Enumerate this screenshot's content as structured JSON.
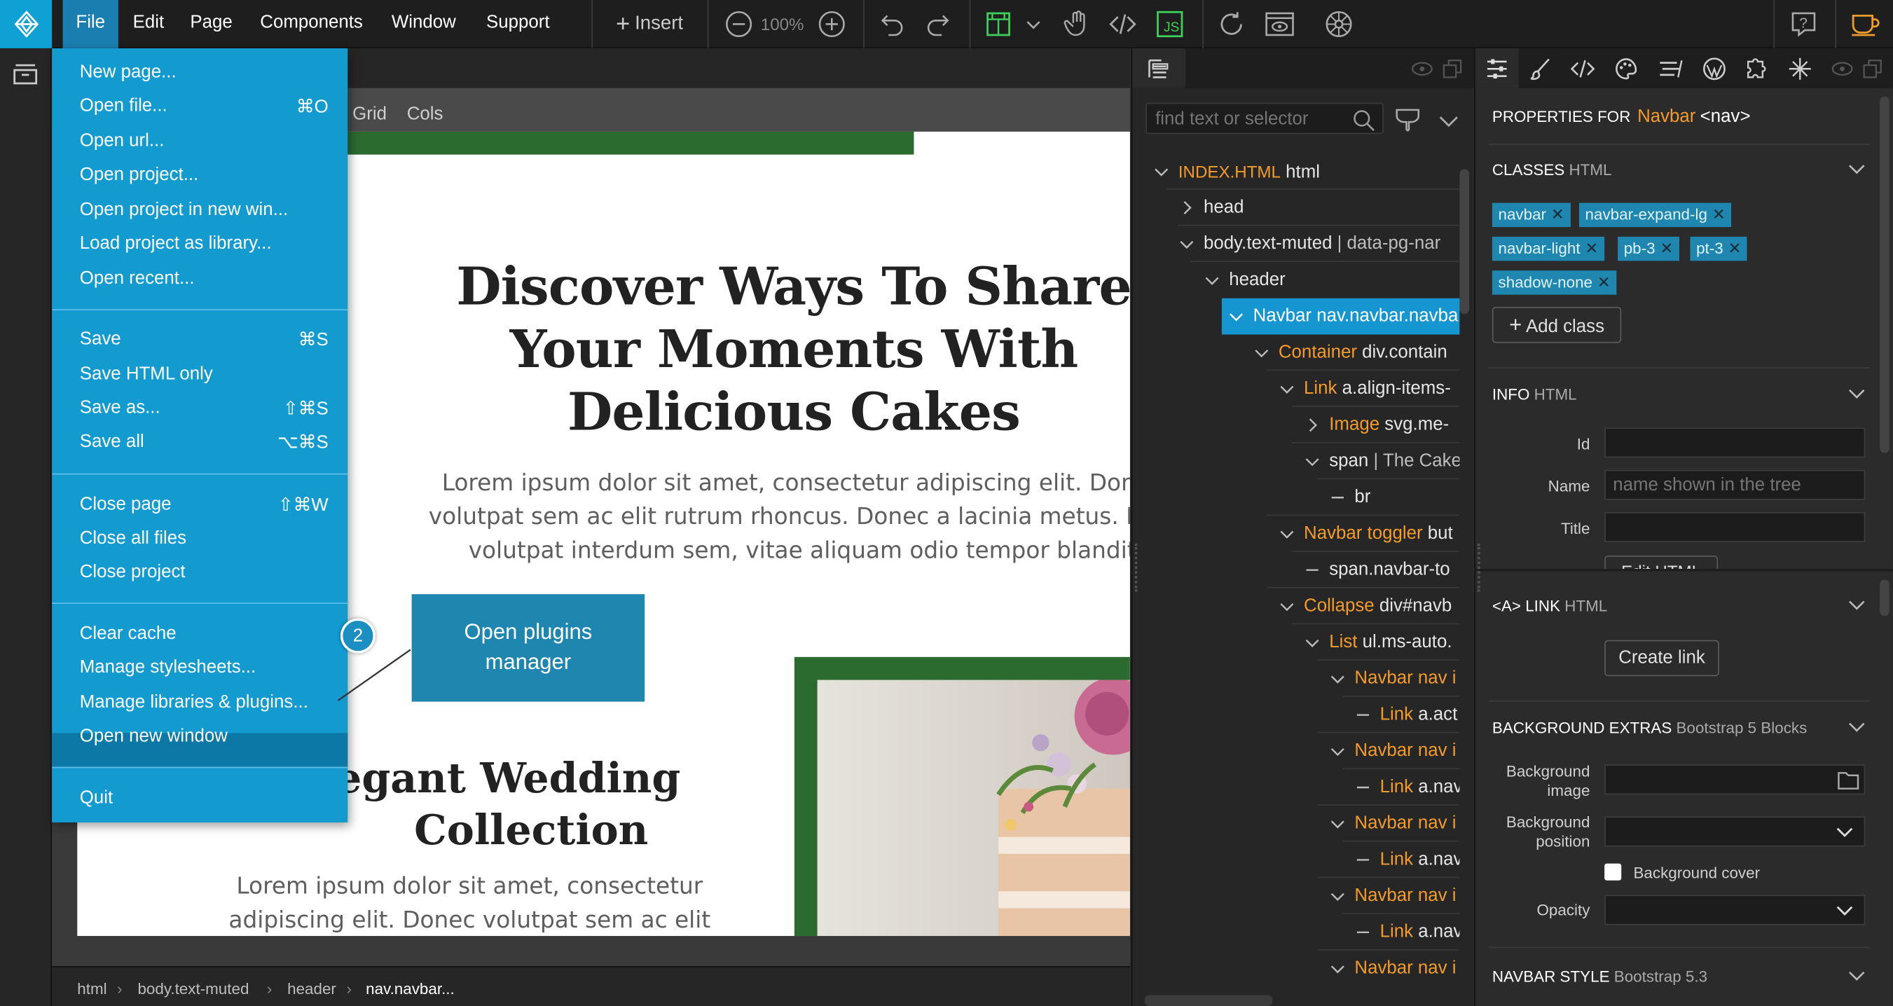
{
  "menubar": {
    "menus": [
      "File",
      "Edit",
      "Page",
      "Components",
      "Window",
      "Support"
    ],
    "insert_label": "Insert",
    "zoom": "100%"
  },
  "file_menu": {
    "items": [
      {
        "label": "New page...",
        "shortcut": ""
      },
      {
        "label": "Open file...",
        "shortcut": "⌘O"
      },
      {
        "label": "Open url...",
        "shortcut": ""
      },
      {
        "label": "Open project...",
        "shortcut": ""
      },
      {
        "label": "Open project in new win...",
        "shortcut": ""
      },
      {
        "label": "Load project as library...",
        "shortcut": ""
      },
      {
        "label": "Open recent...",
        "shortcut": ""
      },
      {
        "label": "Save",
        "shortcut": "⌘S"
      },
      {
        "label": "Save HTML only",
        "shortcut": ""
      },
      {
        "label": "Save as...",
        "shortcut": "⇧⌘S"
      },
      {
        "label": "Save all",
        "shortcut": "⌥⌘S"
      },
      {
        "label": "Close page",
        "shortcut": "⇧⌘W"
      },
      {
        "label": "Close all files",
        "shortcut": ""
      },
      {
        "label": "Close project",
        "shortcut": ""
      },
      {
        "label": "Clear cache",
        "shortcut": ""
      },
      {
        "label": "Manage stylesheets...",
        "shortcut": ""
      },
      {
        "label": "Manage libraries & plugins...",
        "shortcut": ""
      },
      {
        "label": "Open new window",
        "shortcut": ""
      },
      {
        "label": "Quit",
        "shortcut": ""
      }
    ],
    "highlighted": "Manage libraries & plugins..."
  },
  "callout": {
    "badge": "2",
    "line1": "Open plugins",
    "line2": "manager"
  },
  "canvas": {
    "grid_bar": [
      "Grid",
      "Cols"
    ],
    "hero_title_lines": [
      "Discover Ways To Share",
      "Your Moments With",
      "Delicious Cakes"
    ],
    "hero_text_lines": [
      "Lorem ipsum dolor sit amet, consectetur adipiscing elit. Donec",
      "volutpat sem ac elit rutrum rhoncus. Donec a lacinia metus. Mo",
      "volutpat interdum sem, vitae aliquam odio tempor blandit."
    ],
    "section_title_lines": [
      "egant Wedding",
      "Collection"
    ],
    "section_text_lines": [
      "Lorem ipsum dolor sit amet, consectetur",
      "adipiscing elit. Donec volutpat sem ac elit"
    ],
    "accent_green": "#2c6b2f"
  },
  "breadcrumb": [
    "html",
    "body.text-muted",
    "header",
    "nav.navbar..."
  ],
  "tree": {
    "search_placeholder": "find text or selector",
    "rows": [
      {
        "kw": "INDEX.HTML",
        "txt": " html"
      },
      {
        "kw": "",
        "txt": "head"
      },
      {
        "kw": "",
        "txt": "body.text-muted",
        "extra": " | data-pg-nar"
      },
      {
        "kw": "",
        "txt": "header"
      },
      {
        "kw": "Navbar",
        "txt": " nav.navbar.navba"
      },
      {
        "kw": "Container",
        "txt": " div.contain"
      },
      {
        "kw": "Link",
        "txt": " a.align-items-"
      },
      {
        "kw": "Image",
        "txt": " svg.me-"
      },
      {
        "kw": "",
        "txt": "span",
        "extra": " | The Cake"
      },
      {
        "kw": "",
        "txt": "br"
      },
      {
        "kw": "Navbar toggler",
        "txt": " but"
      },
      {
        "kw": "",
        "txt": "span.navbar-to"
      },
      {
        "kw": "Collapse",
        "txt": " div#navb"
      },
      {
        "kw": "List",
        "txt": " ul.ms-auto."
      },
      {
        "kw": "Navbar nav i",
        "txt": ""
      },
      {
        "kw": "Link",
        "txt": " a.act"
      },
      {
        "kw": "Navbar nav i",
        "txt": ""
      },
      {
        "kw": "Link",
        "txt": " a.nav"
      },
      {
        "kw": "Navbar nav i",
        "txt": ""
      },
      {
        "kw": "Link",
        "txt": " a.nav"
      },
      {
        "kw": "Navbar nav i",
        "txt": ""
      },
      {
        "kw": "Link",
        "txt": " a.nav"
      },
      {
        "kw": "Navbar nav i",
        "txt": ""
      }
    ]
  },
  "properties": {
    "title_prefix": "PROPERTIES FOR",
    "title_name": "Navbar",
    "title_tag": "<nav>",
    "classes_header": "CLASSES",
    "classes_sub": "HTML",
    "classes": [
      "navbar",
      "navbar-expand-lg",
      "navbar-light",
      "pb-3",
      "pt-3",
      "shadow-none"
    ],
    "add_class": "Add class",
    "info_header": "INFO",
    "info_sub": "HTML",
    "id_label": "Id",
    "name_label": "Name",
    "name_placeholder": "name shown in the tree",
    "title_label": "Title",
    "edit_html": "Edit HTML",
    "link_header": "<A> LINK",
    "link_sub": "HTML",
    "create_link": "Create link",
    "bg_header": "BACKGROUND EXTRAS",
    "bg_sub": "Bootstrap 5 Blocks",
    "bg_image": [
      "Background",
      "image"
    ],
    "bg_position": [
      "Background",
      "position"
    ],
    "bg_cover": "Background cover",
    "opacity": "Opacity",
    "navbar_style_header": "NAVBAR STYLE",
    "navbar_style_sub": "Bootstrap 5.3"
  }
}
